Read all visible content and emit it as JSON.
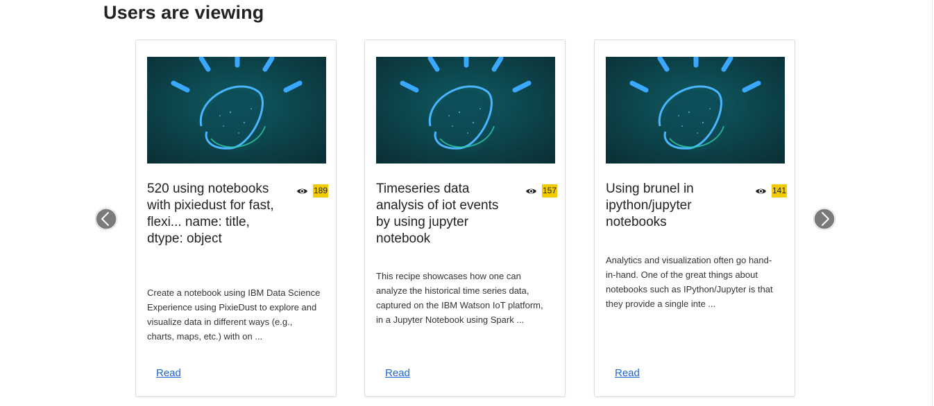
{
  "section": {
    "title": "Users are viewing"
  },
  "cards": [
    {
      "title": "520 using notebooks with pixiedust for fast, flexi... name: title, dtype: object",
      "views": "189",
      "description": "Create a notebook using IBM Data Science Experience using PixieDust to explore and visualize data in different ways (e.g., charts, maps, etc.) with on ...",
      "link": "Read"
    },
    {
      "title": "Timeseries data analysis of iot events by using jupyter notebook",
      "views": "157",
      "description": "This recipe showcases how one can analyze the historical time series data, captured on the IBM Watson IoT platform, in a Jupyter Notebook using Spark ...",
      "link": "Read"
    },
    {
      "title": "Using brunel in ipython/jupyter notebooks",
      "views": "141",
      "description": "Analytics and visualization often go hand-in-hand. One of the great things about notebooks such as IPython/Jupyter is that they provide a single inte ...",
      "link": "Read"
    }
  ],
  "icons": {
    "eye": "eye-icon",
    "prev": "chevron-left-icon",
    "next": "chevron-right-icon"
  },
  "colors": {
    "view_badge": "#f2cc00",
    "link": "#1a66d9",
    "nav_button": "#7a7a7a",
    "image_background": "#0b3a3f",
    "image_glow": "#3aa8ff"
  }
}
